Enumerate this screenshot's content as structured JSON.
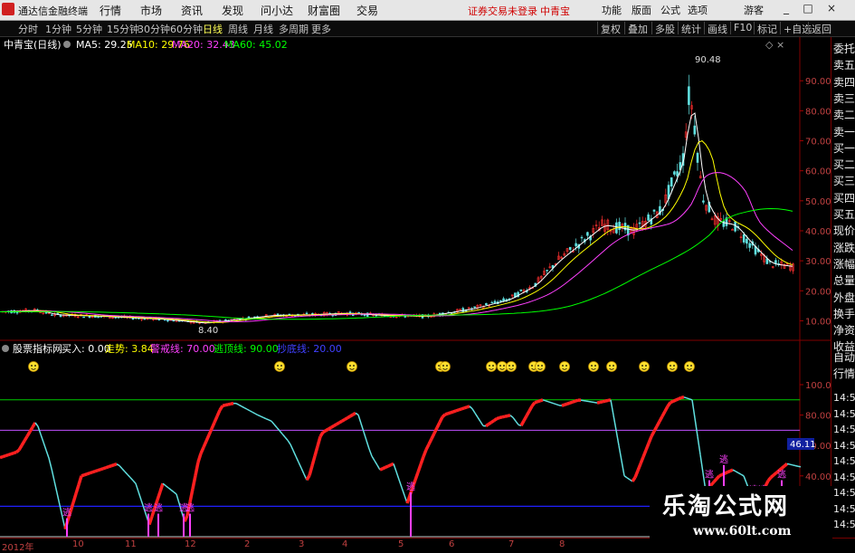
{
  "titlebar": {
    "app_title": "通达信金融终端",
    "menu": [
      "行情",
      "市场",
      "资讯",
      "发现",
      "问小达",
      "财富圈",
      "交易"
    ],
    "warning": "证券交易未登录",
    "stock": "中青宝",
    "right_menu": [
      "功能",
      "版面",
      "公式",
      "选项"
    ],
    "guest": "游客",
    "win_buttons": [
      "_",
      "□",
      "×"
    ]
  },
  "periodbar": {
    "tabs": [
      "分时",
      "1分钟",
      "5分钟",
      "15分钟",
      "30分钟",
      "60分钟",
      "日线",
      "周线",
      "月线",
      "多周期",
      "更多"
    ],
    "active": "日线",
    "tools": [
      "复权",
      "叠加",
      "多股",
      "统计",
      "画线",
      "F10",
      "标记",
      "+自选",
      "返回"
    ]
  },
  "main_chart": {
    "title": "中青宝(日线)",
    "ma": [
      {
        "label": "MA5: 29.25",
        "color": "#ffffff"
      },
      {
        "label": "MA10: 29.76",
        "color": "#ffff00"
      },
      {
        "label": "MA20: 32.43",
        "color": "#ff40ff"
      },
      {
        "label": "MA60: 45.02",
        "color": "#00ff00"
      }
    ],
    "high_label": "90.48",
    "low_label": "8.40",
    "y_ticks": [
      "90.00",
      "80.00",
      "70.00",
      "60.00",
      "50.00",
      "40.00",
      "30.00",
      "20.00",
      "10.00"
    ]
  },
  "indicator": {
    "name": "股票指标网",
    "params": [
      {
        "label": "买入: 0.00",
        "color": "#ffffff"
      },
      {
        "label": "走势: 3.84",
        "color": "#ffff00"
      },
      {
        "label": "警戒线: 70.00",
        "color": "#ff40ff"
      },
      {
        "label": "逃顶线: 90.00",
        "color": "#00ff00"
      },
      {
        "label": "抄底线: 20.00",
        "color": "#4040ff"
      }
    ],
    "y_ticks": [
      "100.00",
      "80.00",
      "60.00",
      "40.00"
    ],
    "current_value": "46.11",
    "signal_text": "逃"
  },
  "right_panel": [
    "委托",
    "卖五",
    "卖四",
    "卖三",
    "卖二",
    "卖一",
    "买一",
    "买二",
    "买三",
    "买四",
    "买五",
    "现价",
    "涨跌",
    "涨幅",
    "总量",
    "外盘",
    "换手",
    "净资",
    "收益",
    "自动",
    "行情",
    "14:56",
    "14:56",
    "14:56",
    "14:56",
    "14:56",
    "14:56",
    "14:56",
    "14:56",
    "14:56"
  ],
  "dates": [
    "2012年",
    "10",
    "11",
    "12",
    "2",
    "3",
    "4",
    "5",
    "6",
    "7",
    "8"
  ],
  "watermark": {
    "title": "乐淘公式网",
    "url": "www.60lt.com"
  },
  "colors": {
    "up": "#ff2020",
    "down": "#60e0e0",
    "ma5": "#ffffff",
    "ma10": "#ffff00",
    "ma20": "#ff40ff",
    "ma60": "#00ff00",
    "warn": "#c050ff",
    "top": "#00cc00",
    "bottom": "#2020ff"
  }
}
